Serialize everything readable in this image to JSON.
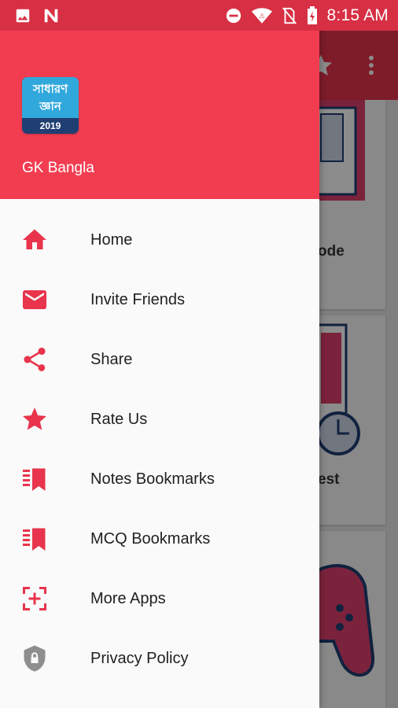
{
  "status_bar": {
    "time": "8:15 AM",
    "icons": [
      "image-icon",
      "n-notification-icon",
      "dnd-icon",
      "wifi-icon",
      "no-sim-icon",
      "battery-icon"
    ]
  },
  "colors": {
    "header": "#f23d51",
    "accent": "#e8344c",
    "icon": "#e8344c",
    "text": "#212121"
  },
  "drawer": {
    "logo": {
      "line1": "সাধারণ",
      "line2": "জ্ঞান",
      "year": "2019"
    },
    "app_name": "GK Bangla",
    "items": [
      {
        "label": "Home",
        "icon": "home-icon"
      },
      {
        "label": "Invite Friends",
        "icon": "mail-icon"
      },
      {
        "label": "Share",
        "icon": "share-icon"
      },
      {
        "label": "Rate Us",
        "icon": "star-icon"
      },
      {
        "label": "Notes Bookmarks",
        "icon": "bookmark-list-icon"
      },
      {
        "label": "MCQ Bookmarks",
        "icon": "bookmark-list-icon"
      },
      {
        "label": "More Apps",
        "icon": "add-app-icon"
      },
      {
        "label": "Privacy Policy",
        "icon": "shield-lock-icon"
      }
    ]
  },
  "background": {
    "card_texts": [
      "ode",
      "est"
    ]
  }
}
